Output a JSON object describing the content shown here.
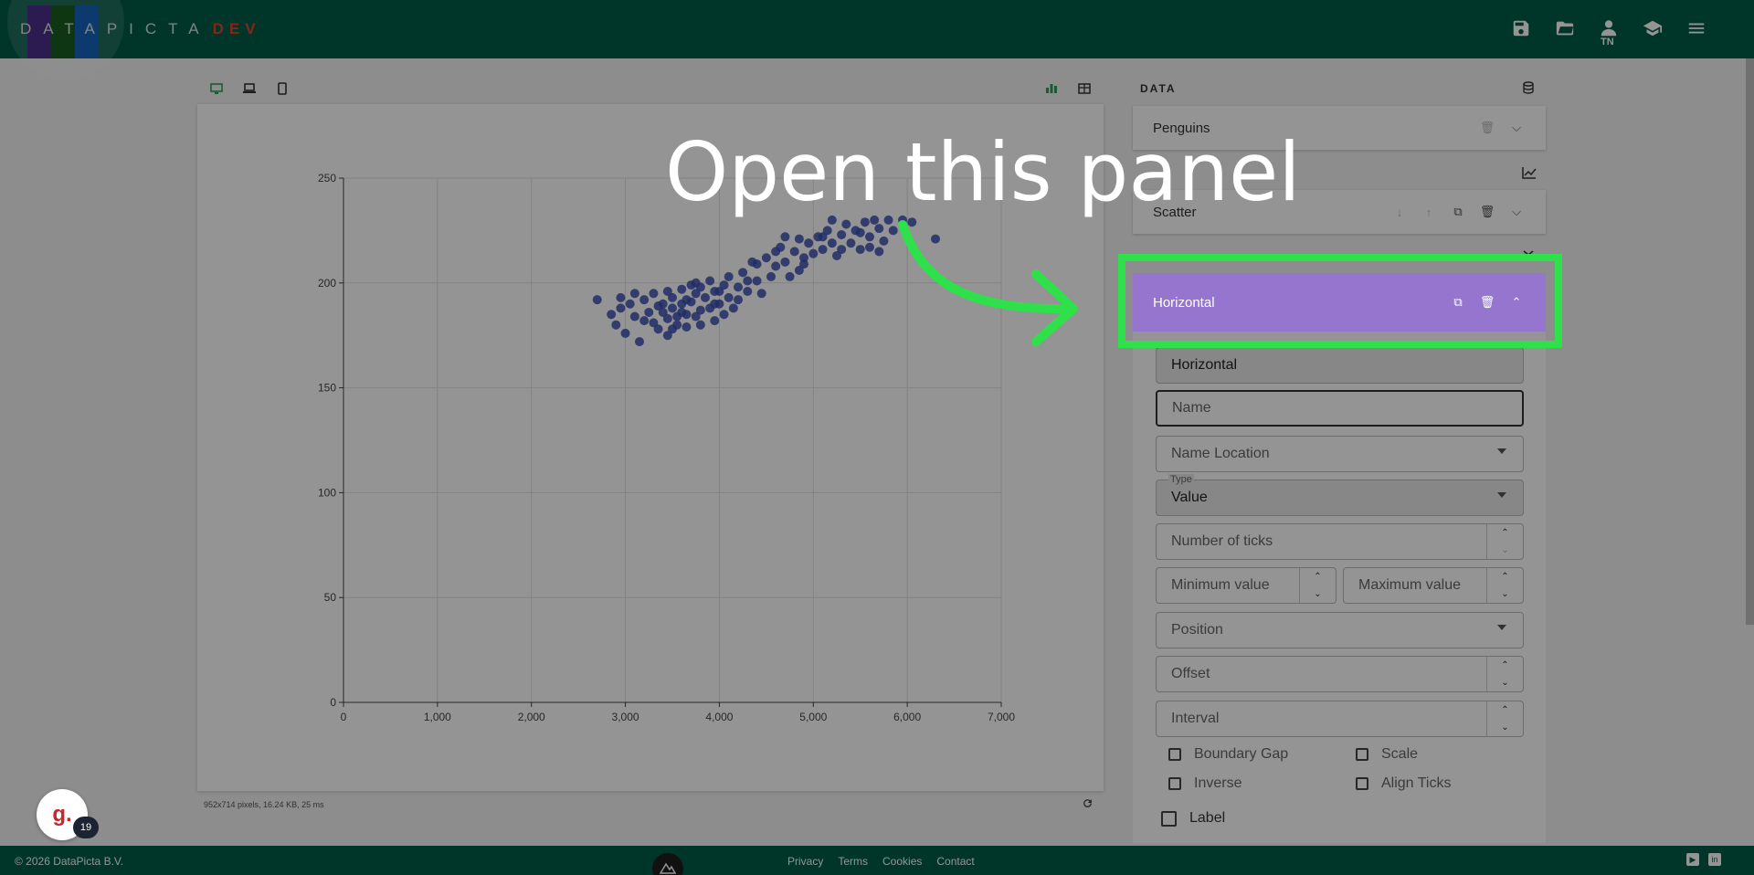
{
  "app": {
    "logo_text": "DATAPICTA",
    "logo_suffix": "DEV",
    "logo_colors": [
      "#4a2f8a",
      "#1b5e20",
      "#1565c0"
    ],
    "user_initials": "TN",
    "header_icons": [
      "save-icon",
      "folder-open-icon",
      "user-icon",
      "graduation-cap-icon",
      "menu-icon"
    ]
  },
  "toolbar": {
    "view_icons": [
      "desktop-icon",
      "laptop-icon",
      "mobile-icon"
    ],
    "mode_icons": [
      "bar-chart-icon",
      "table-icon"
    ]
  },
  "status": {
    "line": "952x714 pixels, 16.24 KB, 25 ms"
  },
  "sidebar": {
    "data_heading": "DATA",
    "dataset_label": "Penguins",
    "series_label": "Scatter",
    "axis_header_label": "Horizontal",
    "axis_fields": {
      "type_select_value": "Horizontal",
      "name_placeholder": "Name",
      "name_location_placeholder": "Name Location",
      "type_tag": "Type",
      "type_value": "Value",
      "number_of_ticks_placeholder": "Number of ticks",
      "minimum_value_placeholder": "Minimum value",
      "maximum_value_placeholder": "Maximum value",
      "position_placeholder": "Position",
      "offset_placeholder": "Offset",
      "interval_placeholder": "Interval"
    },
    "checkboxes": {
      "boundary_gap": "Boundary Gap",
      "scale": "Scale",
      "inverse": "Inverse",
      "align_ticks": "Align Ticks",
      "label": "Label"
    }
  },
  "overlay": {
    "callout_text": "Open this panel",
    "highlight_color": "#2ee04a"
  },
  "bubble": {
    "letter": "g.",
    "count": "19"
  },
  "footer": {
    "copyright": "© 2026 DataPicta B.V.",
    "links": [
      "Privacy",
      "Terms",
      "Cookies",
      "Contact"
    ]
  },
  "chart_data": {
    "type": "scatter",
    "title": "",
    "xlabel": "",
    "ylabel": "",
    "xlim": [
      0,
      7000
    ],
    "ylim": [
      0,
      250
    ],
    "x_ticks": [
      "0",
      "1,000",
      "2,000",
      "3,000",
      "4,000",
      "5,000",
      "6,000",
      "7,000"
    ],
    "y_ticks": [
      "0",
      "50",
      "100",
      "150",
      "200",
      "250"
    ],
    "grid": true,
    "point_color": "#3a4fb3",
    "series": [
      {
        "points": [
          [
            2700,
            192
          ],
          [
            2850,
            185
          ],
          [
            2900,
            180
          ],
          [
            2950,
            188
          ],
          [
            3000,
            176
          ],
          [
            3050,
            190
          ],
          [
            3100,
            184
          ],
          [
            3150,
            172
          ],
          [
            3200,
            192
          ],
          [
            3250,
            186
          ],
          [
            3300,
            195
          ],
          [
            3300,
            181
          ],
          [
            3350,
            178
          ],
          [
            3400,
            190
          ],
          [
            3400,
            186
          ],
          [
            3450,
            196
          ],
          [
            3450,
            175
          ],
          [
            3500,
            188
          ],
          [
            3500,
            193
          ],
          [
            3550,
            180
          ],
          [
            3550,
            184
          ],
          [
            3600,
            197
          ],
          [
            3600,
            190
          ],
          [
            3650,
            185
          ],
          [
            3650,
            179
          ],
          [
            3700,
            199
          ],
          [
            3700,
            191
          ],
          [
            3750,
            184
          ],
          [
            3750,
            195
          ],
          [
            3800,
            187
          ],
          [
            3800,
            180
          ],
          [
            3850,
            193
          ],
          [
            3900,
            201
          ],
          [
            3900,
            188
          ],
          [
            3950,
            196
          ],
          [
            3950,
            182
          ],
          [
            4000,
            190
          ],
          [
            4050,
            199
          ],
          [
            4100,
            203
          ],
          [
            4100,
            193
          ],
          [
            4150,
            188
          ],
          [
            4200,
            198
          ],
          [
            4250,
            205
          ],
          [
            4300,
            196
          ],
          [
            4350,
            210
          ],
          [
            4400,
            201
          ],
          [
            4450,
            195
          ],
          [
            4500,
            212
          ],
          [
            4600,
            208
          ],
          [
            4650,
            217
          ],
          [
            4700,
            210
          ],
          [
            4750,
            203
          ],
          [
            4800,
            215
          ],
          [
            4850,
            221
          ],
          [
            4900,
            212
          ],
          [
            4950,
            219
          ],
          [
            5000,
            214
          ],
          [
            5050,
            222
          ],
          [
            5100,
            216
          ],
          [
            5150,
            225
          ],
          [
            5200,
            219
          ],
          [
            5250,
            213
          ],
          [
            5300,
            223
          ],
          [
            5350,
            228
          ],
          [
            5400,
            219
          ],
          [
            5450,
            225
          ],
          [
            5500,
            216
          ],
          [
            5550,
            229
          ],
          [
            5600,
            222
          ],
          [
            5650,
            230
          ],
          [
            5700,
            226
          ],
          [
            5750,
            220
          ],
          [
            5800,
            230
          ],
          [
            5850,
            225
          ],
          [
            5950,
            230
          ],
          [
            6050,
            229
          ],
          [
            6300,
            221
          ],
          [
            3200,
            182
          ],
          [
            3350,
            189
          ],
          [
            3500,
            178
          ],
          [
            3650,
            192
          ],
          [
            3800,
            198
          ],
          [
            3950,
            190
          ],
          [
            4050,
            185
          ],
          [
            4200,
            192
          ],
          [
            4400,
            209
          ],
          [
            4550,
            203
          ],
          [
            4700,
            222
          ],
          [
            4900,
            209
          ],
          [
            5100,
            222
          ],
          [
            5300,
            216
          ],
          [
            5500,
            224
          ],
          [
            5700,
            215
          ],
          [
            2950,
            193
          ],
          [
            3100,
            195
          ],
          [
            3450,
            183
          ],
          [
            3600,
            186
          ],
          [
            3750,
            200
          ],
          [
            4000,
            196
          ],
          [
            4300,
            201
          ],
          [
            4600,
            215
          ],
          [
            4850,
            206
          ],
          [
            5200,
            230
          ],
          [
            5600,
            217
          ]
        ]
      }
    ]
  }
}
